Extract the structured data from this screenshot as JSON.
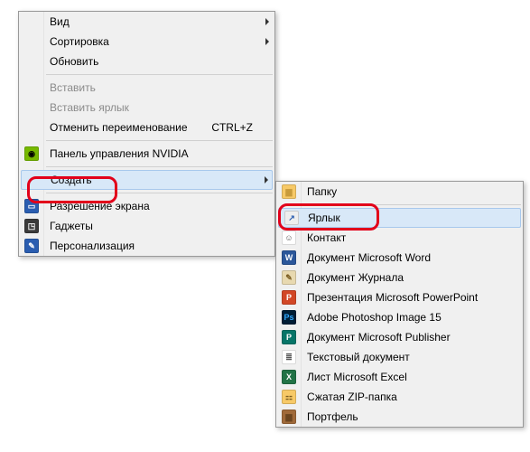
{
  "main_menu": {
    "items": [
      {
        "label": "Вид",
        "icon": null,
        "submenu": true
      },
      {
        "label": "Сортировка",
        "icon": null,
        "submenu": true
      },
      {
        "label": "Обновить",
        "icon": null
      },
      {
        "sep": true
      },
      {
        "label": "Вставить",
        "icon": null,
        "disabled": true
      },
      {
        "label": "Вставить ярлык",
        "icon": null,
        "disabled": true
      },
      {
        "label": "Отменить переименование",
        "icon": null,
        "shortcut": "CTRL+Z"
      },
      {
        "sep": true
      },
      {
        "label": "Панель управления NVIDIA",
        "icon": "nvidia"
      },
      {
        "sep": true
      },
      {
        "label": "Создать",
        "icon": null,
        "submenu": true,
        "highlight": true
      },
      {
        "sep": true
      },
      {
        "label": "Разрешение экрана",
        "icon": "display"
      },
      {
        "label": "Гаджеты",
        "icon": "gadget"
      },
      {
        "label": "Персонализация",
        "icon": "personalize"
      }
    ]
  },
  "sub_menu": {
    "items": [
      {
        "label": "Папку",
        "icon": "folder"
      },
      {
        "sep": true
      },
      {
        "label": "Ярлык",
        "icon": "shortcut",
        "highlight": true
      },
      {
        "label": "Контакт",
        "icon": "contact"
      },
      {
        "label": "Документ Microsoft Word",
        "icon": "word"
      },
      {
        "label": "Документ Журнала",
        "icon": "journal"
      },
      {
        "label": "Презентация Microsoft PowerPoint",
        "icon": "ppt"
      },
      {
        "label": "Adobe Photoshop Image 15",
        "icon": "ps"
      },
      {
        "label": "Документ Microsoft Publisher",
        "icon": "pub"
      },
      {
        "label": "Текстовый документ",
        "icon": "txt"
      },
      {
        "label": "Лист Microsoft Excel",
        "icon": "xls"
      },
      {
        "label": "Сжатая ZIP-папка",
        "icon": "zip"
      },
      {
        "label": "Портфель",
        "icon": "briefcase"
      }
    ]
  },
  "icons": {
    "nvidia": {
      "bg": "#76b900",
      "glyph": "◉",
      "color": "#000"
    },
    "display": {
      "bg": "#2a5db0",
      "glyph": "▭",
      "color": "#fff"
    },
    "gadget": {
      "bg": "#3a3a3a",
      "glyph": "◳",
      "color": "#fff"
    },
    "personalize": {
      "bg": "#2a5db0",
      "glyph": "✎",
      "color": "#fff"
    },
    "folder": {
      "bg": "#f7c967",
      "glyph": "▆",
      "color": "#c89b3b"
    },
    "shortcut": {
      "bg": "#eeeeee",
      "glyph": "↗",
      "color": "#2a5db0"
    },
    "contact": {
      "bg": "#ffffff",
      "glyph": "☺",
      "color": "#555"
    },
    "word": {
      "bg": "#2b579a",
      "glyph": "W",
      "color": "#fff"
    },
    "journal": {
      "bg": "#e8d9b0",
      "glyph": "✎",
      "color": "#7a5c20"
    },
    "ppt": {
      "bg": "#d24726",
      "glyph": "P",
      "color": "#fff"
    },
    "ps": {
      "bg": "#001e36",
      "glyph": "Ps",
      "color": "#31a8ff"
    },
    "pub": {
      "bg": "#077568",
      "glyph": "P",
      "color": "#fff"
    },
    "txt": {
      "bg": "#ffffff",
      "glyph": "≣",
      "color": "#555"
    },
    "xls": {
      "bg": "#217346",
      "glyph": "X",
      "color": "#fff"
    },
    "zip": {
      "bg": "#f7c967",
      "glyph": "⚏",
      "color": "#7a5c20"
    },
    "briefcase": {
      "bg": "#a06a3a",
      "glyph": "▆",
      "color": "#6b4520"
    }
  }
}
